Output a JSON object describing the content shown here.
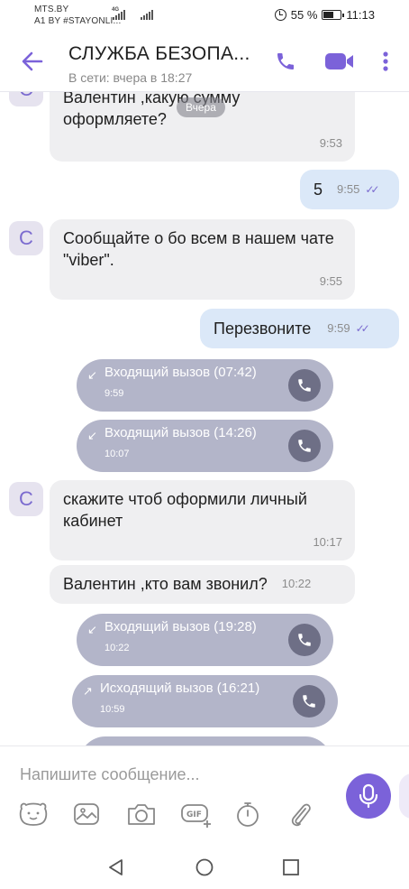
{
  "status_bar": {
    "carrier_line1": "MTS.BY",
    "carrier_line2": "A1 BY #STAYONLI...",
    "network_type": "4G",
    "battery_percent": "55 %",
    "time": "11:13"
  },
  "header": {
    "title": "СЛУЖБА БЕЗОПА...",
    "subtitle": "В сети: вчера в 18:27",
    "back_icon": "arrow-left-icon",
    "call_icon": "phone-icon",
    "video_icon": "video-camera-icon",
    "more_icon": "more-vertical-icon"
  },
  "date_separator": "Вчера",
  "avatar_letter": "C",
  "messages": [
    {
      "id": "m1",
      "dir": "in",
      "text": "Валентин ,какую сумму оформляете?",
      "time": "9:53"
    },
    {
      "id": "m2",
      "dir": "out",
      "text": "5",
      "time": "9:55",
      "status": "read"
    },
    {
      "id": "m3",
      "dir": "in",
      "text": "Сообщайте о бо всем в нашем чате \"viber\".",
      "time": "9:55"
    },
    {
      "id": "m4",
      "dir": "out",
      "text": "Перезвоните",
      "time": "9:59",
      "status": "read"
    },
    {
      "id": "c1",
      "type": "call",
      "text": "Входящий вызов (07:42)",
      "time": "9:59"
    },
    {
      "id": "c2",
      "type": "call",
      "text": "Входящий вызов (14:26)",
      "time": "10:07"
    },
    {
      "id": "m5",
      "dir": "in",
      "text": "скажите чтоб оформили личный кабинет",
      "time": "10:17"
    },
    {
      "id": "m6",
      "dir": "in",
      "text": "Валентин ,кто вам звонил?",
      "time": "10:22"
    },
    {
      "id": "c3",
      "type": "call",
      "text": "Входящий вызов (19:28)",
      "time": "10:22"
    },
    {
      "id": "c4",
      "type": "call",
      "text": "Исходящий вызов (16:21)",
      "time": "10:59"
    }
  ],
  "composer": {
    "placeholder": "Напишите сообщение...",
    "tools": [
      "sticker-icon",
      "gallery-icon",
      "camera-icon",
      "gif-icon",
      "timer-icon",
      "attachment-icon"
    ],
    "mic_icon": "microphone-icon"
  },
  "colors": {
    "accent": "#7b62d9",
    "incoming_bubble": "#efeff1",
    "outgoing_bubble": "#dbe8f8",
    "call_bubble": "#b3b5c9"
  }
}
